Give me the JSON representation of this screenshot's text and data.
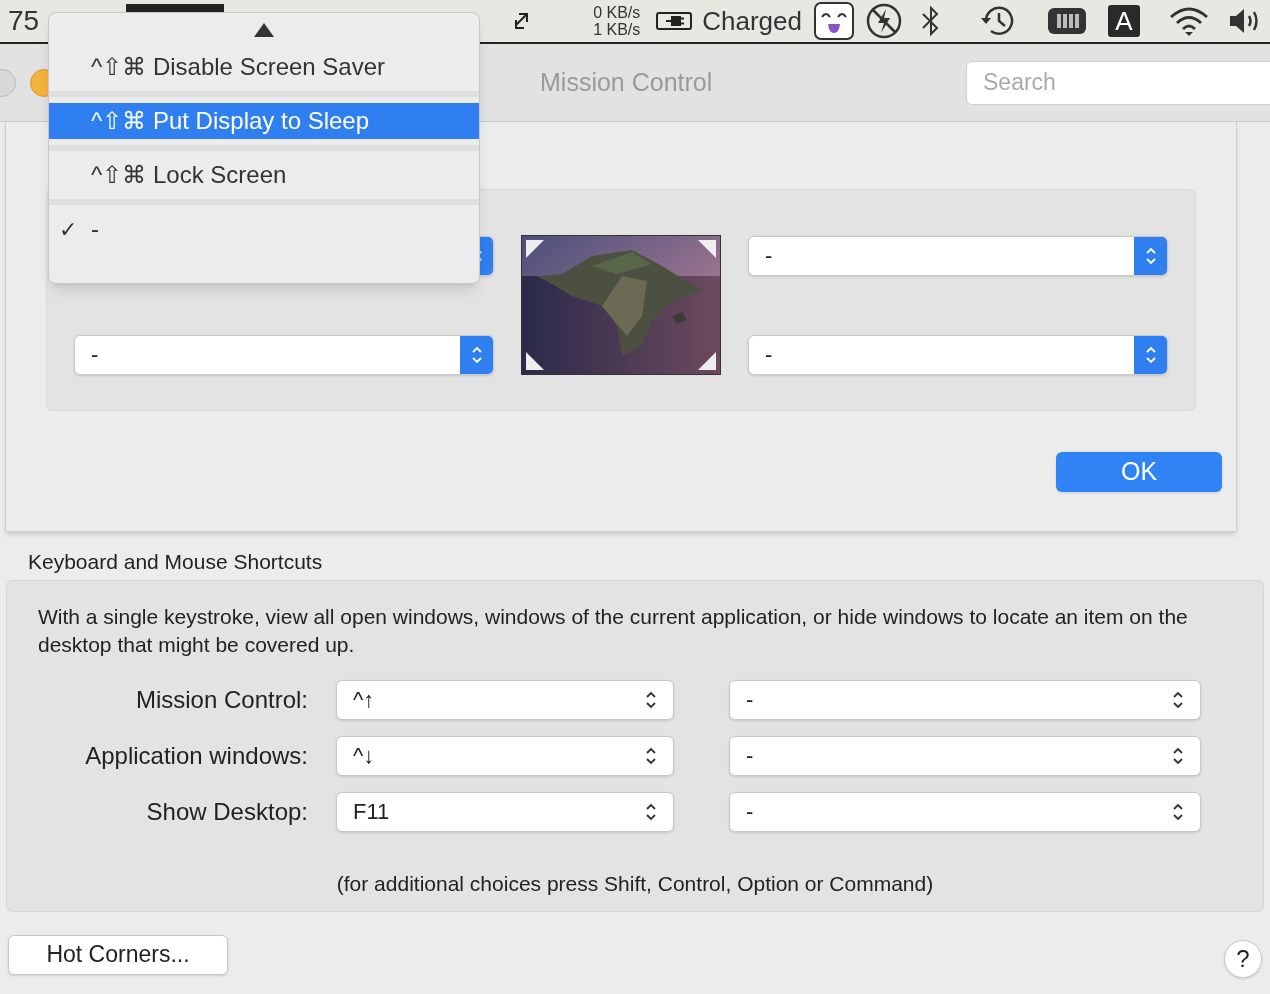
{
  "menu_bar": {
    "cut_text": "75",
    "network": {
      "down": "0 KB/s",
      "up": "1 KB/s"
    },
    "battery_label": "Charged",
    "input_source": "A"
  },
  "window": {
    "title": "Mission Control",
    "search": {
      "placeholder": "Search"
    }
  },
  "hot_corners": {
    "corners": [
      {
        "value": "-"
      },
      {
        "value": "-"
      },
      {
        "value": "-"
      }
    ],
    "menu": {
      "check_mark": "✓",
      "items": [
        {
          "label": "^⇧⌘ Disable Screen Saver",
          "selected": false,
          "checked": false
        },
        {
          "label": "^⇧⌘ Put Display to Sleep",
          "selected": true,
          "checked": false
        },
        {
          "label": "^⇧⌘ Lock Screen",
          "selected": false,
          "checked": false
        },
        {
          "label": "-",
          "selected": false,
          "checked": true
        }
      ]
    },
    "ok_button": "OK"
  },
  "shortcuts": {
    "heading": "Keyboard and Mouse Shortcuts",
    "description": "With a single keystroke, view all open windows, windows of the current application, or hide windows to locate an item on the desktop that might be covered up.",
    "rows": [
      {
        "label": "Mission Control:",
        "keyboard": "^↑",
        "mouse": "-"
      },
      {
        "label": "Application windows:",
        "keyboard": "^↓",
        "mouse": "-"
      },
      {
        "label": "Show Desktop:",
        "keyboard": "F11",
        "mouse": "-"
      }
    ],
    "note": "(for additional choices press Shift, Control, Option or Command)"
  },
  "hot_corners_button": "Hot Corners...",
  "help_button": "?"
}
